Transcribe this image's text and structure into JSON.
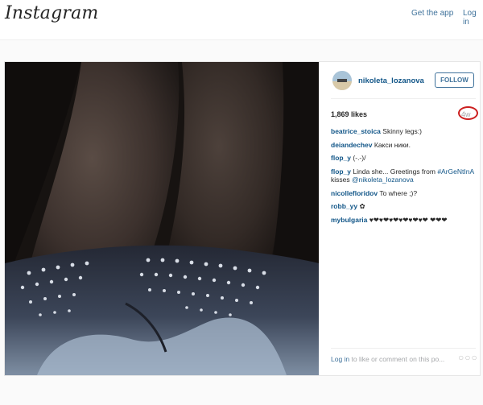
{
  "header": {
    "logo": "Instagram",
    "get_app": "Get the app",
    "login": "Log in"
  },
  "post": {
    "username": "nikoleta_lozanova",
    "follow_label": "FOLLOW",
    "likes": "1,869 likes",
    "time": "4w",
    "comments": [
      {
        "user": "beatrice_stoica",
        "text": "Skinny legs:)"
      },
      {
        "user": "deiandechev",
        "text": "Какси ники."
      },
      {
        "user": "flop_y",
        "text": "(-.-)/"
      },
      {
        "user": "flop_y",
        "text": "Linda she... Greetings from",
        "hashtag": "#ArGeNtInA",
        "mid": "kisses",
        "mention": "@nikoleta_lozanova"
      },
      {
        "user": "nicollefloridov",
        "text": "To where ;)?"
      },
      {
        "user": "robb_yy",
        "text": "✿"
      },
      {
        "user": "mybulgaria",
        "text": "♥❤♥❤♥❤♥❤♥❤♥❤ ❤❤❤"
      }
    ],
    "cta_link": "Log in",
    "cta_text": "to like or comment on this po...",
    "more": "○○○"
  },
  "colors": {
    "link": "#125688",
    "accent": "#3f729b",
    "muted": "#a5a7aa",
    "highlight_circle": "#cc1f1f"
  }
}
